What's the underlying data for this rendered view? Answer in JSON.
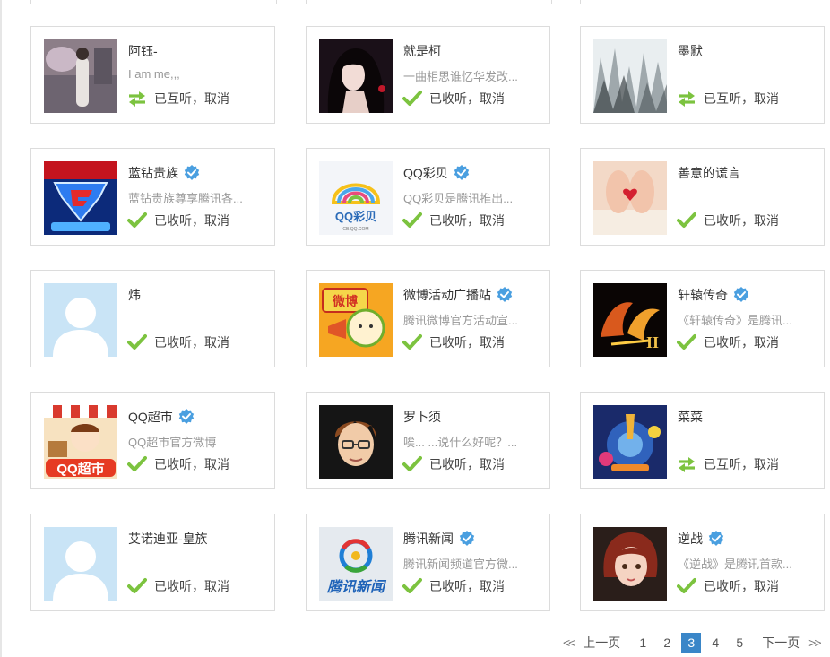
{
  "cards": [
    {
      "name": "阿钰-",
      "verified": false,
      "desc": "I am me,,,",
      "status": "mutual",
      "status_text": "已互听，",
      "cancel": "取消",
      "avatar": "photo-girl-standing"
    },
    {
      "name": "就是柯",
      "verified": false,
      "desc": "一曲相思谁忆华发改...",
      "status": "following",
      "status_text": "已收听，",
      "cancel": "取消",
      "avatar": "anime-girl-long-hair"
    },
    {
      "name": "墨默",
      "verified": false,
      "desc": "",
      "status": "mutual",
      "status_text": "已互听，",
      "cancel": "取消",
      "avatar": "ink-landscape"
    },
    {
      "name": "蓝钻贵族",
      "verified": true,
      "desc": "蓝钻贵族尊享腾讯各...",
      "status": "following",
      "status_text": "已收听，",
      "cancel": "取消",
      "avatar": "blue-diamond-logo"
    },
    {
      "name": "QQ彩贝",
      "verified": true,
      "desc": "QQ彩贝是腾讯推出...",
      "status": "following",
      "status_text": "已收听，",
      "cancel": "取消",
      "avatar": "qq-caibei-logo"
    },
    {
      "name": "善意的谎言",
      "verified": false,
      "desc": "",
      "status": "following",
      "status_text": "已收听，",
      "cancel": "取消",
      "avatar": "feet-heart-photo"
    },
    {
      "name": "炜",
      "verified": false,
      "desc": "",
      "status": "following",
      "status_text": "已收听，",
      "cancel": "取消",
      "avatar": "default-person"
    },
    {
      "name": "微博活动广播站",
      "verified": true,
      "desc": "腾讯微博官方活动宣...",
      "status": "following",
      "status_text": "已收听，",
      "cancel": "取消",
      "avatar": "weibo-broadcast-cartoon"
    },
    {
      "name": "轩辕传奇",
      "verified": true,
      "desc": "《轩辕传奇》是腾讯...",
      "status": "following",
      "status_text": "已收听，",
      "cancel": "取消",
      "avatar": "xuanyuan-game-logo"
    },
    {
      "name": "QQ超市",
      "verified": true,
      "desc": "QQ超市官方微博",
      "status": "following",
      "status_text": "已收听，",
      "cancel": "取消",
      "avatar": "qq-supermarket-cartoon"
    },
    {
      "name": "罗卜须",
      "verified": false,
      "desc": "唉... ...说什么好呢？...",
      "status": "following",
      "status_text": "已收听，",
      "cancel": "取消",
      "avatar": "boy-glasses-cartoon"
    },
    {
      "name": "菜菜",
      "verified": false,
      "desc": "",
      "status": "mutual",
      "status_text": "已互听，",
      "cancel": "取消",
      "avatar": "fantasy-game-art"
    },
    {
      "name": "艾诺迪亚-皇族",
      "verified": false,
      "desc": "",
      "status": "following",
      "status_text": "已收听，",
      "cancel": "取消",
      "avatar": "default-person"
    },
    {
      "name": "腾讯新闻",
      "verified": true,
      "desc": "腾讯新闻频道官方微...",
      "status": "following",
      "status_text": "已收听，",
      "cancel": "取消",
      "avatar": "tencent-news-logo"
    },
    {
      "name": "逆战",
      "verified": true,
      "desc": "《逆战》是腾讯首款...",
      "status": "following",
      "status_text": "已收听，",
      "cancel": "取消",
      "avatar": "red-hair-girl-game"
    }
  ],
  "pagination": {
    "prev_label": "上一页",
    "next_label": "下一页",
    "pages": [
      "1",
      "2",
      "3",
      "4",
      "5"
    ],
    "current": "3"
  },
  "colors": {
    "check_green": "#7cc33f",
    "verified_blue": "#4a9fe0",
    "active_page": "#3a86c8",
    "desc_gray": "#999999",
    "border": "#dcdcdc"
  }
}
